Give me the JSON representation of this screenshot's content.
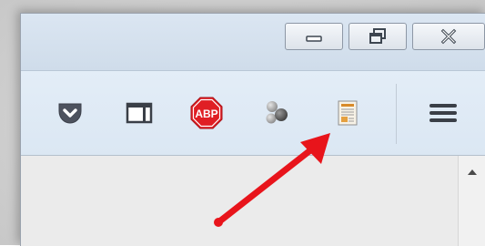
{
  "titlebar": {
    "buttons": [
      {
        "name": "minimize",
        "icon": "minimize-icon"
      },
      {
        "name": "restore",
        "icon": "restore-icon"
      },
      {
        "name": "close",
        "icon": "close-icon"
      }
    ]
  },
  "toolbar": {
    "items": [
      {
        "name": "pocket",
        "icon": "pocket-icon",
        "color": "#4d525e"
      },
      {
        "name": "sidebar",
        "icon": "sidebar-icon",
        "color": "#3a3f47"
      },
      {
        "name": "adblock-plus",
        "icon": "abp-icon",
        "label": "ABP",
        "color": "#e01f24"
      },
      {
        "name": "extension",
        "icon": "extension-icon",
        "color": "#6e6e6e"
      },
      {
        "name": "reader",
        "icon": "reader-icon",
        "color": "#d88a2a"
      },
      {
        "name": "menu",
        "icon": "hamburger-menu-icon",
        "color": "#3a3f47"
      }
    ]
  },
  "annotation": {
    "arrow_color": "#e8141b"
  },
  "colors": {
    "titlebar": "#d5e1ee",
    "toolbar": "#dfeaf5",
    "content": "#ebebeb"
  }
}
